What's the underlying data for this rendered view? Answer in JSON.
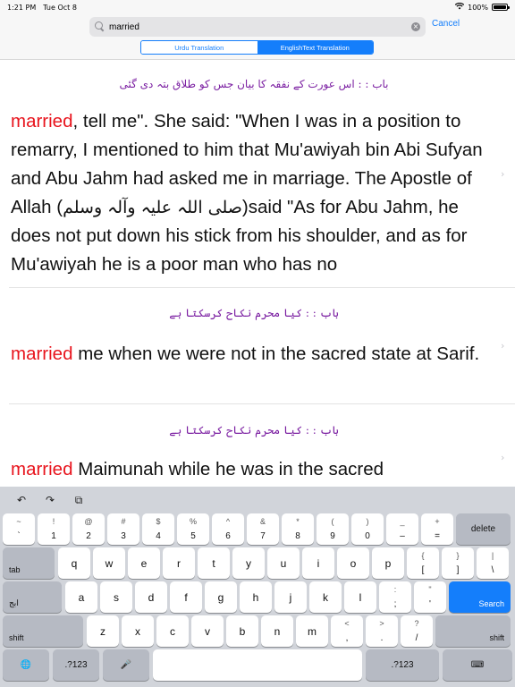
{
  "status": {
    "time": "1:21 PM",
    "date": "Tue Oct 8",
    "battery": "100%"
  },
  "search": {
    "value": "married",
    "cancel": "Cancel"
  },
  "segment": {
    "left": "Urdu Translation",
    "right": "EnglishText Translation"
  },
  "results": [
    {
      "title": "باب : : اس عورت کے نفقہ کا بیان جس کو طلاق بتہ دی گئی",
      "highlight": "married",
      "text_before": ", tell me\". She said: \"When I was in a position to remarry, I mentioned to him that Mu'awiyah bin Abi Sufyan and Abu Jahm had asked me in marriage. The Apostle of Allah (",
      "arabic": "صلی اللہ علیہ وآلہ وسلم",
      "text_after": ")said \"As for Abu Jahm, he does not put down his stick from his shoulder, and as for Mu'awiyah he is a poor man who has no"
    },
    {
      "title": "باب : : کیا محرم نکاح کرسکتا ہے",
      "highlight": "married",
      "text_after": " me when we were not in the sacred state at Sarif."
    },
    {
      "title": "باب : : کیا محرم نکاح کرسکتا ہے",
      "highlight": "married",
      "text_after": " Maimunah while he was in the sacred"
    }
  ],
  "keyboard": {
    "shortcuts": [
      "↶",
      "↷",
      "⧉"
    ],
    "row1": [
      {
        "top": "~",
        "bottom": "`"
      },
      {
        "top": "!",
        "bottom": "1"
      },
      {
        "top": "@",
        "bottom": "2"
      },
      {
        "top": "#",
        "bottom": "3"
      },
      {
        "top": "$",
        "bottom": "4"
      },
      {
        "top": "%",
        "bottom": "5"
      },
      {
        "top": "^",
        "bottom": "6"
      },
      {
        "top": "&",
        "bottom": "7"
      },
      {
        "top": "*",
        "bottom": "8"
      },
      {
        "top": "(",
        "bottom": "9"
      },
      {
        "top": ")",
        "bottom": "0"
      },
      {
        "top": "_",
        "bottom": "–"
      },
      {
        "top": "+",
        "bottom": "="
      }
    ],
    "delete": "delete",
    "tab": "tab",
    "row2": [
      "q",
      "w",
      "e",
      "r",
      "t",
      "y",
      "u",
      "i",
      "o",
      "p"
    ],
    "row2_extra": [
      {
        "top": "{",
        "bottom": "["
      },
      {
        "top": "}",
        "bottom": "]"
      },
      {
        "top": "|",
        "bottom": "\\"
      }
    ],
    "lang": "ابج",
    "row3": [
      "a",
      "s",
      "d",
      "f",
      "g",
      "h",
      "j",
      "k",
      "l"
    ],
    "row3_extra": [
      {
        "top": ":",
        "bottom": ";"
      },
      {
        "top": "\"",
        "bottom": "'"
      }
    ],
    "search": "Search",
    "shift": "shift",
    "row4": [
      "z",
      "x",
      "c",
      "v",
      "b",
      "n",
      "m"
    ],
    "row4_extra": [
      {
        "top": "<",
        "bottom": ","
      },
      {
        "top": ">",
        "bottom": "."
      },
      {
        "top": "?",
        "bottom": "/"
      }
    ],
    "num_label": ".?123",
    "globe": "🌐",
    "mic": "🎤",
    "hide": "⌨"
  },
  "colors": {
    "accent": "#147efb",
    "highlight": "#e8141d",
    "title": "#7b1fa2"
  }
}
